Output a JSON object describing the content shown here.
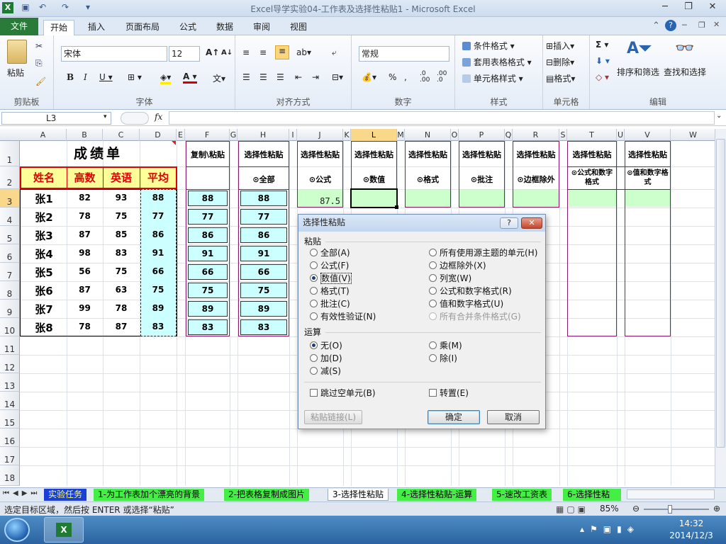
{
  "window": {
    "title": "Excel导学实验04-工作表及选择性粘贴1  -  Microsoft Excel"
  },
  "tabs": [
    "文件",
    "开始",
    "插入",
    "页面布局",
    "公式",
    "数据",
    "审阅",
    "视图"
  ],
  "ribbon": {
    "clipboard": {
      "paste": "粘贴",
      "label": "剪贴板"
    },
    "font": {
      "name": "宋体",
      "size": "12",
      "label": "字体"
    },
    "align": {
      "label": "对齐方式"
    },
    "number": {
      "format": "常规",
      "label": "数字"
    },
    "styles": {
      "cond": "条件格式",
      "table": "套用表格格式",
      "cell": "单元格样式",
      "label": "样式"
    },
    "cells": {
      "insert": "插入",
      "delete": "删除",
      "format": "格式",
      "label": "单元格"
    },
    "edit": {
      "sort": "排序和筛选",
      "find": "查找和选择",
      "label": "编辑"
    }
  },
  "formula_bar": {
    "name_box": "L3",
    "fx": "fx",
    "value": ""
  },
  "columns": [
    "A",
    "B",
    "C",
    "D",
    "E",
    "F",
    "G",
    "H",
    "I",
    "J",
    "K",
    "L",
    "M",
    "N",
    "O",
    "P",
    "Q",
    "R",
    "S",
    "T",
    "U",
    "V",
    "W"
  ],
  "rows": [
    "1",
    "2",
    "3",
    "4",
    "5",
    "6",
    "7",
    "8",
    "9",
    "10",
    "11",
    "12",
    "13",
    "14",
    "15",
    "16",
    "17",
    "18"
  ],
  "sheet": {
    "title": "成绩单",
    "headers": [
      "姓名",
      "高数",
      "英语",
      "平均"
    ],
    "names": [
      "张1",
      "张2",
      "张3",
      "张4",
      "张5",
      "张6",
      "张7",
      "张8"
    ],
    "math": [
      "82",
      "78",
      "87",
      "98",
      "56",
      "87",
      "99",
      "78"
    ],
    "english": [
      "93",
      "75",
      "85",
      "83",
      "75",
      "63",
      "78",
      "87"
    ],
    "avg": [
      "88",
      "77",
      "86",
      "91",
      "66",
      "75",
      "89",
      "83"
    ],
    "copy_header": "复制\\粘贴",
    "paste_header": "选择性粘贴",
    "options": [
      "⊙全部",
      "⊙公式",
      "⊙数值",
      "⊙格式",
      "⊙批注",
      "⊙边框除外",
      "⊙公式和数字格式",
      "⊙值和数字格式"
    ],
    "j3": "87.5"
  },
  "dialog": {
    "title": "选择性粘贴",
    "help": "?",
    "paste_label": "粘贴",
    "left_options": [
      "全部(A)",
      "公式(F)",
      "数值(V)",
      "格式(T)",
      "批注(C)",
      "有效性验证(N)"
    ],
    "right_options": [
      "所有使用源主题的单元(H)",
      "边框除外(X)",
      "列宽(W)",
      "公式和数字格式(R)",
      "值和数字格式(U)",
      "所有合并条件格式(G)"
    ],
    "op_label": "运算",
    "op_left": [
      "无(O)",
      "加(D)",
      "减(S)"
    ],
    "op_right": [
      "乘(M)",
      "除(I)"
    ],
    "skip_blanks": "跳过空单元(B)",
    "transpose": "转置(E)",
    "paste_link": "粘贴链接(L)",
    "ok": "确定",
    "cancel": "取消"
  },
  "sheet_tabs": [
    "实验任务",
    "1-为工作表加个漂亮的背景",
    "2-把表格复制成图片",
    "3-选择性粘贴",
    "4-选择性粘贴-运算",
    "5-速改工资表",
    "6-选择性粘"
  ],
  "status": {
    "text": "选定目标区域，然后按 ENTER 或选择“粘贴”",
    "zoom": "85%"
  },
  "taskbar": {
    "time": "14:32",
    "date": "2014/12/3"
  }
}
